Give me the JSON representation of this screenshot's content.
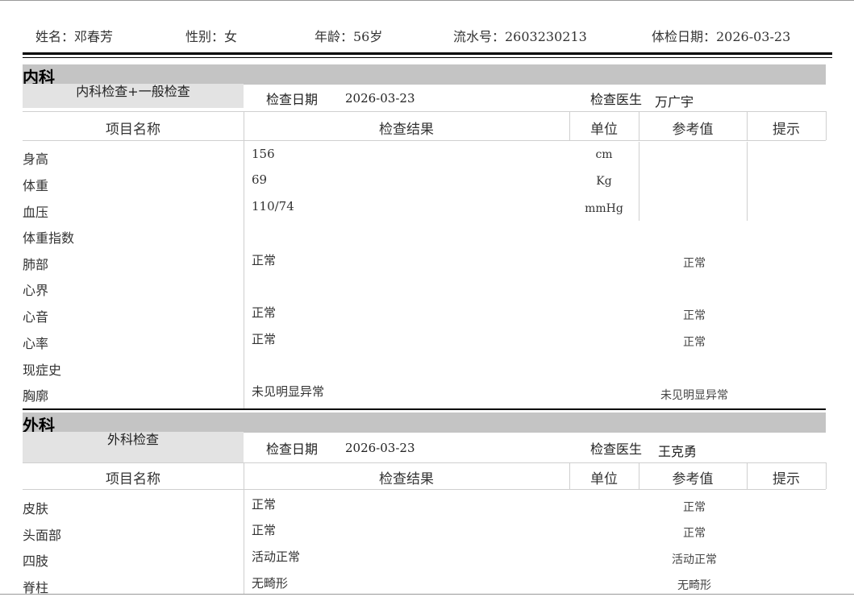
{
  "patient": {
    "name": "姓名：邓春芳",
    "sex": "性别：女",
    "age": "年龄：56岁",
    "serial": "流水号：2603230213",
    "exam_date": "体检日期：2026-03-23"
  },
  "columns": {
    "item": "项目名称",
    "result": "检查结果",
    "unit": "单位",
    "ref": "参考值",
    "hint": "提示"
  },
  "internal": {
    "title": "内科",
    "sub": "内科检查+一般检查",
    "date_label": "检查日期",
    "date": "2026-03-23",
    "doctor_label": "检查医生",
    "doctor": "万广宇",
    "rows": [
      {
        "name": "身高",
        "result": "156",
        "unit": "cm",
        "ref": ""
      },
      {
        "name": "体重",
        "result": "69",
        "unit": "Kg",
        "ref": ""
      },
      {
        "name": "血压",
        "result": "110/74",
        "unit": "mmHg",
        "ref": ""
      },
      {
        "name": "体重指数",
        "result": "",
        "unit": "",
        "ref": ""
      },
      {
        "name": "肺部",
        "result": "正常",
        "unit": "",
        "ref": "正常"
      },
      {
        "name": "心界",
        "result": "",
        "unit": "",
        "ref": ""
      },
      {
        "name": "心音",
        "result": "正常",
        "unit": "",
        "ref": "正常"
      },
      {
        "name": "心率",
        "result": "正常",
        "unit": "",
        "ref": "正常"
      },
      {
        "name": "现症史",
        "result": "",
        "unit": "",
        "ref": ""
      },
      {
        "name": "胸廓",
        "result": "未见明显异常",
        "unit": "",
        "ref": "未见明显异常"
      }
    ]
  },
  "surgery": {
    "title": "外科",
    "sub": "外科检查",
    "date_label": "检查日期",
    "date": "2026-03-23",
    "doctor_label": "检查医生",
    "doctor": "王克勇",
    "rows": [
      {
        "name": "皮肤",
        "result": "正常",
        "unit": "",
        "ref": "正常"
      },
      {
        "name": "头面部",
        "result": "正常",
        "unit": "",
        "ref": "正常"
      },
      {
        "name": "四肢",
        "result": "活动正常",
        "unit": "",
        "ref": "活动正常"
      },
      {
        "name": "脊柱",
        "result": "无畸形",
        "unit": "",
        "ref": "无畸形"
      }
    ]
  }
}
